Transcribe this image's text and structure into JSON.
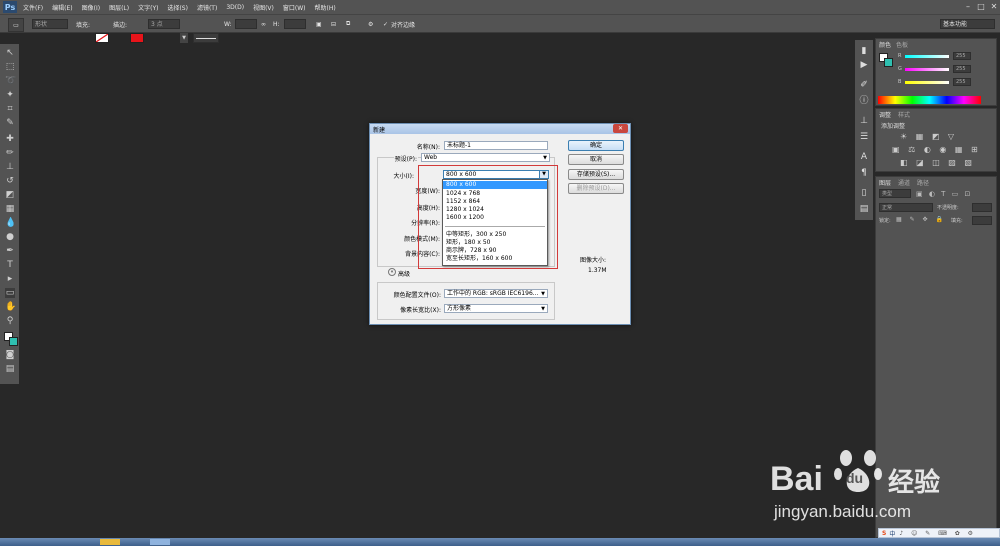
{
  "app": {
    "logo": "Ps"
  },
  "menu": [
    "文件(F)",
    "编辑(E)",
    "图像(I)",
    "图层(L)",
    "文字(Y)",
    "选择(S)",
    "滤镜(T)",
    "3D(D)",
    "视图(V)",
    "窗口(W)",
    "帮助(H)"
  ],
  "window_controls": {
    "minimize": "–",
    "maximize": "□",
    "close": "✕"
  },
  "options_bar": {
    "shape_mode": "形状",
    "fill_label": "填充:",
    "stroke_label": "描边:",
    "stroke_width": "3 点",
    "w_label": "W:",
    "h_label": "H:",
    "align_edges": "对齐边缘",
    "workspace": "基本功能"
  },
  "panels": {
    "color_tabs": [
      "颜色",
      "色板"
    ],
    "color_values": [
      "255",
      "255",
      "255"
    ],
    "color_letters": [
      "R",
      "G",
      "B"
    ],
    "adjust_tabs": [
      "调整",
      "样式"
    ],
    "adjust_hint": "添加调整",
    "layers_tabs": [
      "图层",
      "通道",
      "路径"
    ],
    "layers_kind": "类型",
    "blend_mode": "正常",
    "opacity_label": "不透明度:",
    "lock_label": "锁定:",
    "fill_label": "填充:"
  },
  "dialog": {
    "title": "新建",
    "name_label": "名称(N):",
    "name_value": "未标题-1",
    "preset_label": "预设(P):",
    "preset_value": "Web",
    "size_label": "大小(I):",
    "size_value": "800 x 600",
    "width_label": "宽度(W):",
    "height_label": "高度(H):",
    "resolution_label": "分辨率(R):",
    "color_mode_label": "颜色模式(M):",
    "bg_label": "背景内容(C):",
    "advanced_label": "高级",
    "profile_label": "颜色配置文件(O):",
    "profile_value": "工作中的 RGB: sRGB IEC6196...",
    "aspect_label": "像素长宽比(X):",
    "aspect_value": "方形像素",
    "ok": "确定",
    "cancel": "取消",
    "save_preset": "存储预设(S)...",
    "delete_preset": "删除预设(D)...",
    "image_size_label": "图像大小:",
    "image_size_value": "1.37M",
    "size_options": [
      "800 x 600",
      "1024 x 768",
      "1152 x 864",
      "1280 x 1024",
      "1600 x 1200",
      "中等矩形，300 x 250",
      "矩形，180 x 50",
      "商示牌，728 x 90",
      "宽至长矩形，160 x 600"
    ]
  },
  "watermark": {
    "brand": "Bai",
    "brand2": "du",
    "cn": "经验",
    "url": "jingyan.baidu.com"
  },
  "taskbar": {
    "ime": "中"
  },
  "colors": {
    "ui_gray": "#535353",
    "canvas": "#282828",
    "accent_red": "#e8141a",
    "selection": "#3399ff"
  }
}
